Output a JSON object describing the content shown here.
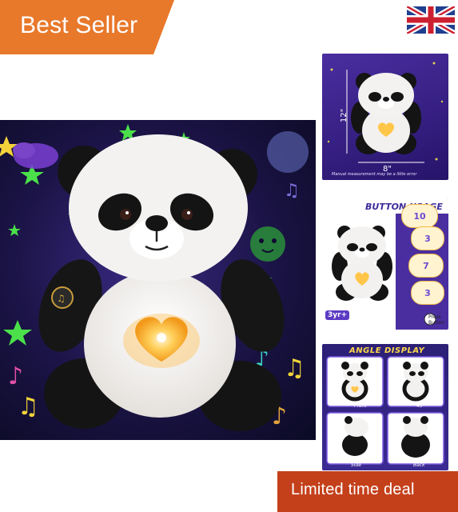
{
  "badges": {
    "best_seller": "Best Seller",
    "limited_deal": "Limited time deal"
  },
  "flag": {
    "icon": "uk-flag-icon"
  },
  "thumbnails": {
    "size_view": {
      "height_label": "12\"",
      "width_label": "8\"",
      "caption": "Manual measurement may be a little error"
    },
    "button_usage": {
      "title": "BUTTON USAGE",
      "age_label": "3yr+",
      "press_label": "Press Button",
      "modes": [
        "10",
        "3",
        "7",
        "3"
      ]
    },
    "angle_display": {
      "title": "ANGLE DISPLAY",
      "views": [
        "Front",
        "45°",
        "Side",
        "Back"
      ]
    }
  },
  "colors": {
    "best_seller_bg": "#e8782a",
    "limited_deal_bg": "#c4401b",
    "night_sky": "#1a1344",
    "panda_black": "#141414",
    "panda_white": "#f4f2f0",
    "heart_glow": "#ffb534"
  }
}
